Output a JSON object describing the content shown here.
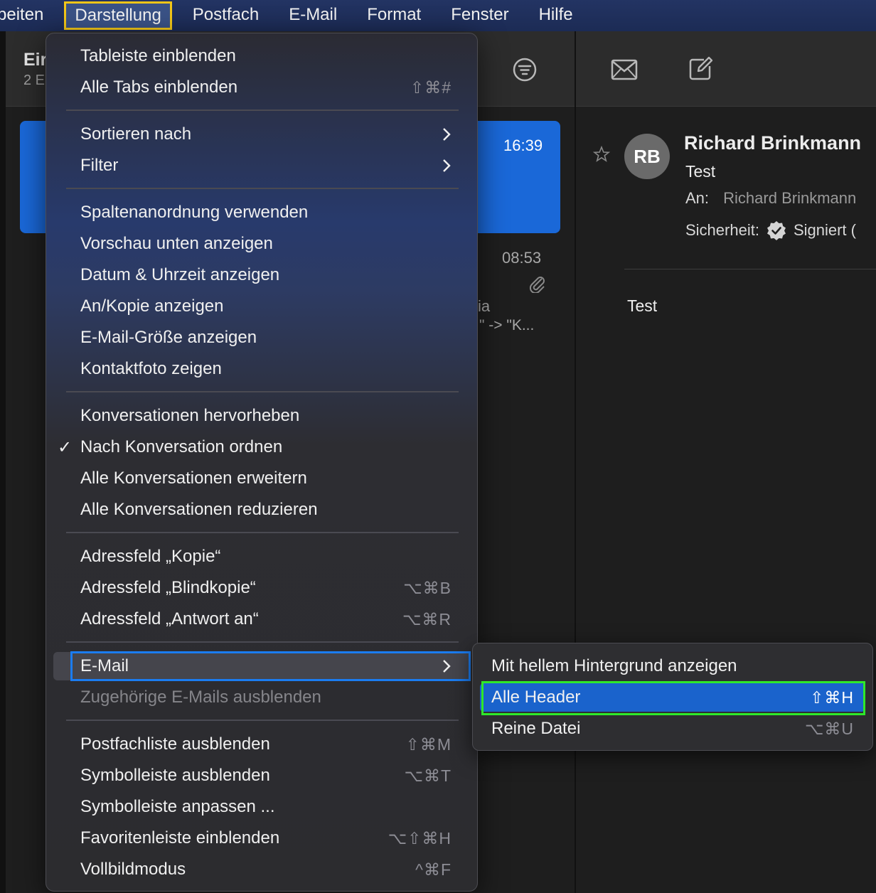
{
  "menubar": {
    "items": [
      "beiten",
      "Darstellung",
      "Postfach",
      "E-Mail",
      "Format",
      "Fenster",
      "Hilfe"
    ]
  },
  "mail_list": {
    "title": "Eir",
    "subtitle": "2 E",
    "message1_time": "16:39",
    "message2_time": "08:53",
    "message2_fragment1": "ia",
    "message2_fragment2": "\" -> \"K..."
  },
  "reader": {
    "avatar_initials": "RB",
    "sender": "Richard Brinkmann",
    "subject": "Test",
    "to_label": "An:",
    "to_value": "Richard Brinkmann",
    "security_label": "Sicherheit:",
    "security_value": "Signiert (",
    "body": "Test"
  },
  "view_menu": {
    "items": [
      {
        "label": "Tableiste einblenden",
        "shortcut": ""
      },
      {
        "label": "Alle Tabs einblenden",
        "shortcut": "⇧⌘#"
      },
      {
        "label": "Sortieren nach",
        "shortcut": ""
      },
      {
        "label": "Filter",
        "shortcut": ""
      },
      {
        "label": "Spaltenanordnung verwenden",
        "shortcut": ""
      },
      {
        "label": "Vorschau unten anzeigen",
        "shortcut": ""
      },
      {
        "label": "Datum & Uhrzeit anzeigen",
        "shortcut": ""
      },
      {
        "label": "An/Kopie anzeigen",
        "shortcut": ""
      },
      {
        "label": "E-Mail-Größe anzeigen",
        "shortcut": ""
      },
      {
        "label": "Kontaktfoto zeigen",
        "shortcut": ""
      },
      {
        "label": "Konversationen hervorheben",
        "shortcut": ""
      },
      {
        "label": "Nach Konversation ordnen",
        "shortcut": "",
        "check": "✓"
      },
      {
        "label": "Alle Konversationen erweitern",
        "shortcut": ""
      },
      {
        "label": "Alle Konversationen reduzieren",
        "shortcut": ""
      },
      {
        "label": "Adressfeld „Kopie“",
        "shortcut": ""
      },
      {
        "label": "Adressfeld „Blindkopie“",
        "shortcut": "⌥⌘B"
      },
      {
        "label": "Adressfeld „Antwort an“",
        "shortcut": "⌥⌘R"
      },
      {
        "label": "E-Mail",
        "shortcut": ""
      },
      {
        "label": "Zugehörige E-Mails ausblenden",
        "shortcut": ""
      },
      {
        "label": "Postfachliste ausblenden",
        "shortcut": "⇧⌘M"
      },
      {
        "label": "Symbolleiste ausblenden",
        "shortcut": "⌥⌘T"
      },
      {
        "label": "Symbolleiste anpassen ...",
        "shortcut": ""
      },
      {
        "label": "Favoritenleiste einblenden",
        "shortcut": "⌥⇧⌘H"
      },
      {
        "label": "Vollbildmodus",
        "shortcut": "^⌘F"
      }
    ]
  },
  "email_submenu": {
    "items": [
      {
        "label": "Mit hellem Hintergrund anzeigen",
        "shortcut": ""
      },
      {
        "label": "Alle Header",
        "shortcut": "⇧⌘H"
      },
      {
        "label": "Reine Datei",
        "shortcut": "⌥⌘U"
      }
    ]
  },
  "colors": {
    "menubar": "#1c2b55",
    "selection_blue": "#1a68d8",
    "highlight_yellow": "#f2c618",
    "highlight_blue": "#1b7cf0",
    "highlight_green": "#2ee82a"
  }
}
